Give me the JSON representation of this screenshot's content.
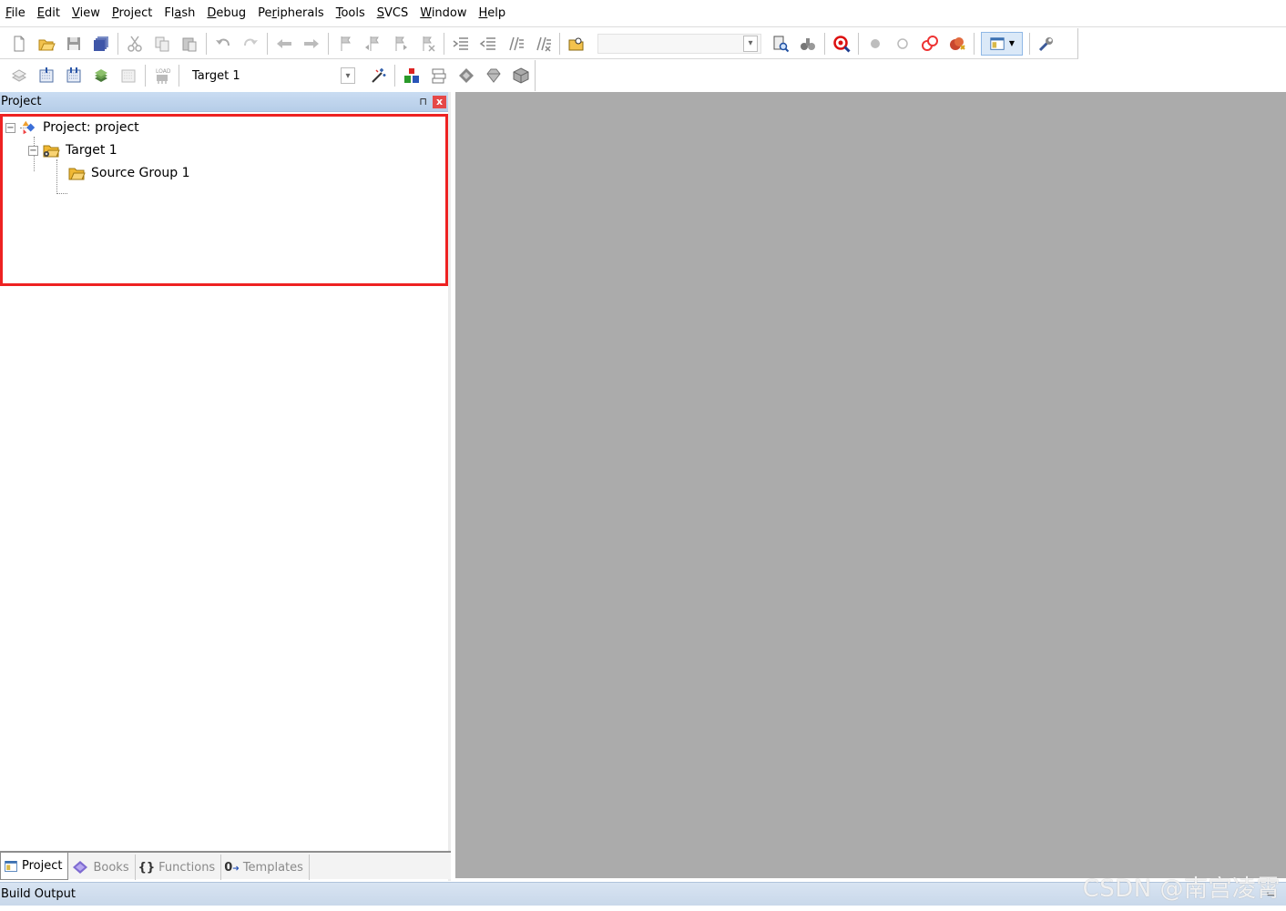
{
  "menu": [
    {
      "mn": "F",
      "rest": "ile"
    },
    {
      "mn": "E",
      "rest": "dit"
    },
    {
      "mn": "V",
      "rest": "iew"
    },
    {
      "mn": "P",
      "rest": "roject"
    },
    {
      "pre": "Fl",
      "mn": "a",
      "rest": "sh"
    },
    {
      "mn": "D",
      "rest": "ebug"
    },
    {
      "pre": "Pe",
      "mn": "r",
      "rest": "ipherals"
    },
    {
      "mn": "T",
      "rest": "ools"
    },
    {
      "mn": "S",
      "rest": "VCS"
    },
    {
      "mn": "W",
      "rest": "indow"
    },
    {
      "mn": "H",
      "rest": "elp"
    }
  ],
  "toolbar2": {
    "target_value": "Target 1"
  },
  "panel": {
    "title": "Project",
    "close": "x",
    "pin": "⊓"
  },
  "tree": {
    "project": "Project: project",
    "target": "Target 1",
    "group": "Source Group 1",
    "expander": "−"
  },
  "tabs": [
    "Project",
    "Books",
    "Functions",
    "Templates"
  ],
  "build_output": {
    "title": "Build Output"
  },
  "watermark": "CSDN @南宫凌霄",
  "colors": {
    "highlight": "#ee2222",
    "editor_bg": "#ababab",
    "panel_title": "#c9dcf2"
  }
}
